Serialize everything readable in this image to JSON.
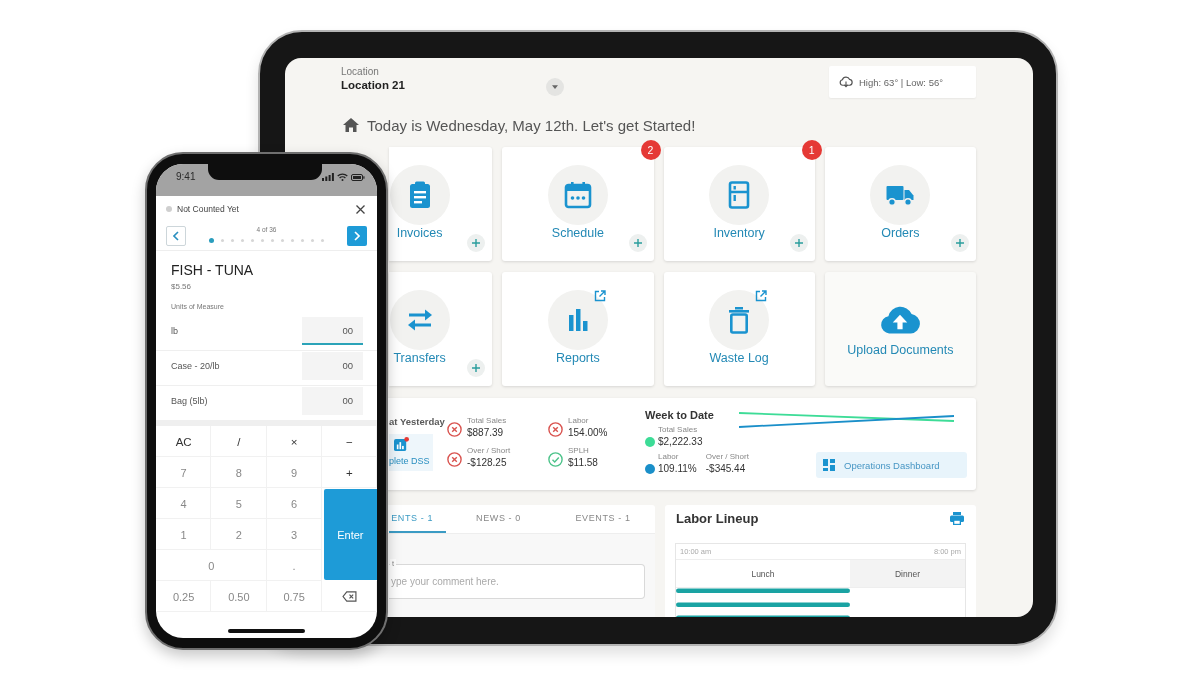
{
  "tablet": {
    "header": {
      "location_label": "Location",
      "location": "Location 21",
      "weather": "High: 63° | Low: 56°"
    },
    "greeting": "Today is Wednesday, May 12th. Let's get Started!",
    "tiles": [
      {
        "label": "Invoices",
        "kind": "module",
        "add": true,
        "external": false
      },
      {
        "label": "Schedule",
        "kind": "module",
        "add": true,
        "external": false,
        "badge": "2"
      },
      {
        "label": "Inventory",
        "kind": "module",
        "add": true,
        "external": false,
        "badge": "1"
      },
      {
        "label": "Orders",
        "kind": "module",
        "add": true,
        "external": false
      },
      {
        "label": "Transfers",
        "kind": "module",
        "add": true,
        "external": false
      },
      {
        "label": "Reports",
        "kind": "module",
        "add": false,
        "external": true
      },
      {
        "label": "Waste Log",
        "kind": "module",
        "add": false,
        "external": true
      },
      {
        "label": "Upload Documents",
        "kind": "action",
        "add": false,
        "external": false
      }
    ],
    "yesterday": {
      "title": "at Yesterday",
      "action": "plete DSS",
      "metrics": [
        {
          "label": "Total Sales",
          "value": "$887.39",
          "met": false
        },
        {
          "label": "Labor",
          "value": "154.00%",
          "met": false
        },
        {
          "label": "Over / Short",
          "value": "-$128.25",
          "met": false
        },
        {
          "label": "SPLH",
          "value": "$11.58",
          "met": true
        }
      ]
    },
    "week_to_date": {
      "title": "Week to Date",
      "metrics": [
        {
          "label": "Total Sales",
          "value": "$2,222.33",
          "color": "#3ddc97"
        },
        {
          "label": "Labor",
          "value": "109.11%",
          "color": "#1a8fc9"
        },
        {
          "label": "Over / Short",
          "value": "-$345.44"
        }
      ],
      "button": "Operations Dashboard"
    },
    "feed": {
      "tabs": [
        {
          "label": "ENTS - 1",
          "selected": true
        },
        {
          "label": "NEWS - 0",
          "selected": false
        },
        {
          "label": "EVENTS - 1",
          "selected": false
        }
      ],
      "comment_field": {
        "label": "t",
        "placeholder": "ype your comment here."
      }
    },
    "labor_lineup": {
      "title": "Labor Lineup",
      "start_time": "10:00 am",
      "end_time": "8:00 pm",
      "shifts": [
        {
          "label": "Lunch",
          "selected": true
        },
        {
          "label": "Dinner",
          "selected": false
        }
      ]
    }
  },
  "phone": {
    "status_bar": {
      "time": "9:41"
    },
    "sheet": {
      "status": "Not Counted Yet",
      "counter": "4 of 36",
      "dots": [
        {
          "selected": true
        },
        {
          "selected": false
        },
        {
          "selected": false
        },
        {
          "selected": false
        },
        {
          "selected": false
        },
        {
          "selected": false
        },
        {
          "selected": false
        },
        {
          "selected": false
        },
        {
          "selected": false
        },
        {
          "selected": false
        },
        {
          "selected": false
        },
        {
          "selected": false
        }
      ],
      "item": {
        "name": "FISH - TUNA",
        "price": "$5.56"
      },
      "units_heading": "Units of Measure",
      "units": [
        {
          "label": "lb",
          "value": "00",
          "focused": true
        },
        {
          "label": "Case - 20/lb",
          "value": "00",
          "focused": false
        },
        {
          "label": "Bag (5lb)",
          "value": "00",
          "focused": false
        }
      ],
      "keypad": [
        {
          "label": "AC",
          "kind": "op"
        },
        {
          "label": "/",
          "kind": "op"
        },
        {
          "label": "×",
          "kind": "op"
        },
        {
          "label": "−",
          "kind": "op"
        },
        {
          "label": "7",
          "kind": "digit"
        },
        {
          "label": "8",
          "kind": "digit"
        },
        {
          "label": "9",
          "kind": "digit"
        },
        {
          "label": "+",
          "kind": "op"
        },
        {
          "label": "4",
          "kind": "digit"
        },
        {
          "label": "5",
          "kind": "digit"
        },
        {
          "label": "6",
          "kind": "digit"
        },
        {
          "label": "1",
          "kind": "digit"
        },
        {
          "label": "2",
          "kind": "digit"
        },
        {
          "label": "3",
          "kind": "digit"
        },
        {
          "label": "0",
          "kind": "wide"
        },
        {
          "label": ".",
          "kind": "digit"
        },
        {
          "label": "Enter",
          "kind": "enter"
        },
        {
          "label": "0.25",
          "kind": "digit"
        },
        {
          "label": "0.50",
          "kind": "digit"
        },
        {
          "label": "0.75",
          "kind": "digit"
        },
        {
          "kind": "delete"
        }
      ]
    }
  }
}
